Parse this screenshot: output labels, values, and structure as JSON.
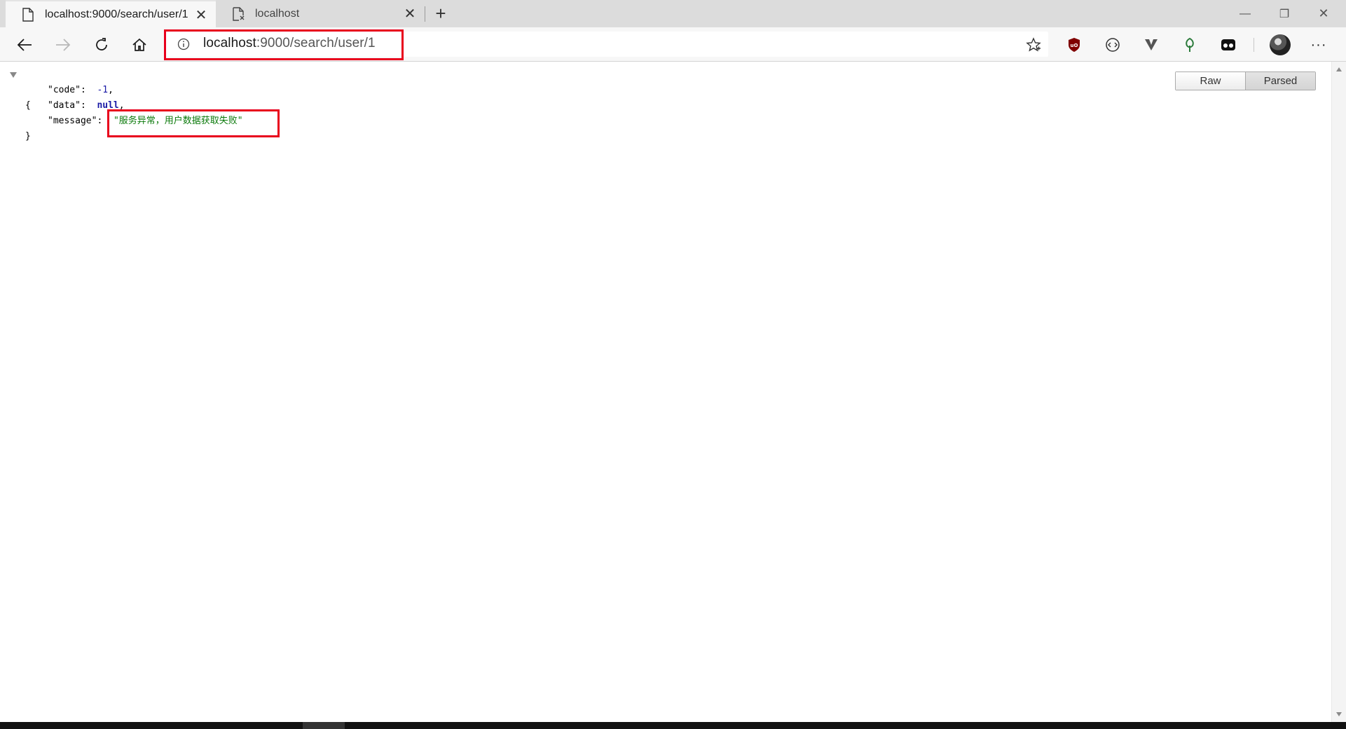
{
  "tabs": [
    {
      "title": "localhost:9000/search/user/1",
      "icon": "page-icon",
      "active": true
    },
    {
      "title": "localhost",
      "icon": "error-page-icon",
      "active": false
    }
  ],
  "window_controls": {
    "minimize": "—",
    "restore": "❐",
    "close": "✕"
  },
  "tab_close_glyph": "✕",
  "new_tab_glyph": "+",
  "address_bar": {
    "host": "localhost",
    "path": ":9000/search/user/1"
  },
  "extensions": [
    "ublock-icon",
    "script-icon",
    "vivaldi-v-icon",
    "leaf-icon",
    "coupon-icon"
  ],
  "more_menu": "···",
  "json_viewer": {
    "open_brace": "{",
    "close_brace": "}",
    "entries": [
      {
        "key": "\"code\"",
        "colon": ":  ",
        "value": "-1",
        "trail": ","
      },
      {
        "key": "\"data\"",
        "colon": ":  ",
        "value": "null",
        "trail": ","
      },
      {
        "key": "\"message\"",
        "colon": ":  ",
        "value": "\"服务异常，用户数据获取失败\"",
        "trail": ""
      }
    ]
  },
  "view_buttons": {
    "raw": "Raw",
    "parsed": "Parsed",
    "selected": "Parsed"
  },
  "colors": {
    "highlight_box": "#e8001c",
    "string_value": "#0b7a0b",
    "number_value": "#1a1aa6"
  }
}
